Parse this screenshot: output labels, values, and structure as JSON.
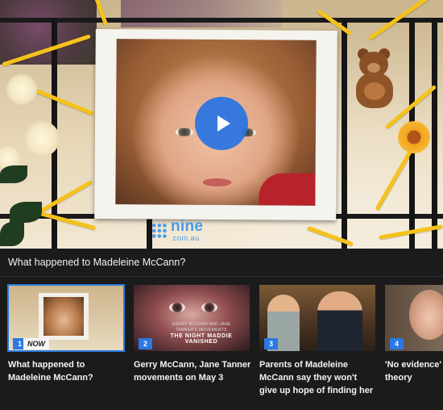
{
  "player": {
    "play_label": "",
    "brand_word": "nine",
    "brand_sub": ".com.au"
  },
  "video": {
    "title": "What happened to Madeleine McCann?"
  },
  "playlist": {
    "items": [
      {
        "index": "1",
        "title": "What happened to Madeleine McCann?",
        "now_label": "NOW",
        "active": true
      },
      {
        "index": "2",
        "title": "Gerry McCann, Jane Tanner movements on May 3",
        "thumb_caption_small": "GERRY MCCANN AND JANE TANNER'S MOVEMENTS",
        "thumb_caption_big": "THE NIGHT MADDIE VANISHED"
      },
      {
        "index": "3",
        "title": "Parents of Madeleine McCann say they won't give up hope of finding her"
      },
      {
        "index": "4",
        "title": "'No evidence' latest Madelei theory"
      }
    ]
  },
  "colors": {
    "accent_blue": "#2a78e3",
    "background": "#1b1b1c"
  },
  "icons": {
    "play": "play-icon",
    "brand": "nine-logo-icon"
  }
}
